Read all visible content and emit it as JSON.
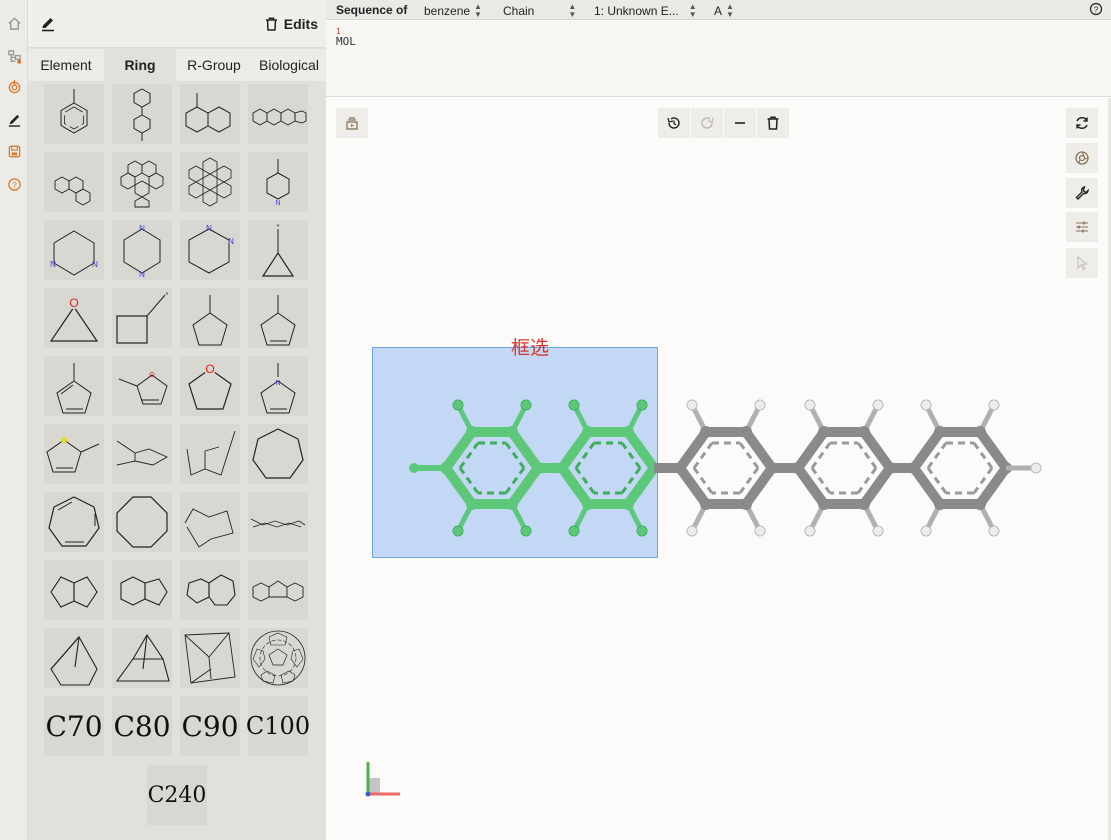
{
  "nav": {
    "items": [
      "home-icon",
      "hierarchy-icon",
      "target-icon",
      "pencil-icon",
      "save-icon",
      "help-icon"
    ],
    "active_color": "#d97b2c"
  },
  "panel": {
    "edits_label": "Edits",
    "tabs": [
      "Element",
      "Ring",
      "R-Group",
      "Biological"
    ],
    "active_tab": "Ring",
    "fullerenes": [
      "C70",
      "C80",
      "C90",
      "C100",
      "C240"
    ]
  },
  "sequence": {
    "label": "Sequence of",
    "molecule": "benzene",
    "chain": "Chain",
    "entity": "1: Unknown E...",
    "model": "A",
    "index": "1",
    "text": "MOL"
  },
  "viewer": {
    "selection_label": "框选"
  },
  "colors": {
    "selection_fill": "#c3d9f4",
    "selected_atoms": "#5ec87a",
    "carbon": "#8a8a8a",
    "hydrogen": "#ececec",
    "nitrogen": "#3a3ae0",
    "oxygen": "#e02020",
    "sulfur": "#e8d834"
  }
}
